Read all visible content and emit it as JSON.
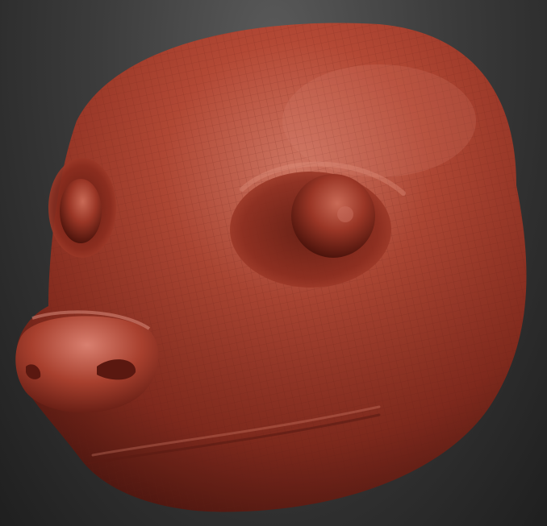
{
  "scene": {
    "subject": "sculpted-animal-head",
    "background_top": "#5a5a5a",
    "background_bottom": "#1f1f1f",
    "material": {
      "base": "#b64a36",
      "highlight": "#e08a78",
      "shadow": "#5a1a12",
      "wireframe": "#7a2a1c"
    }
  }
}
